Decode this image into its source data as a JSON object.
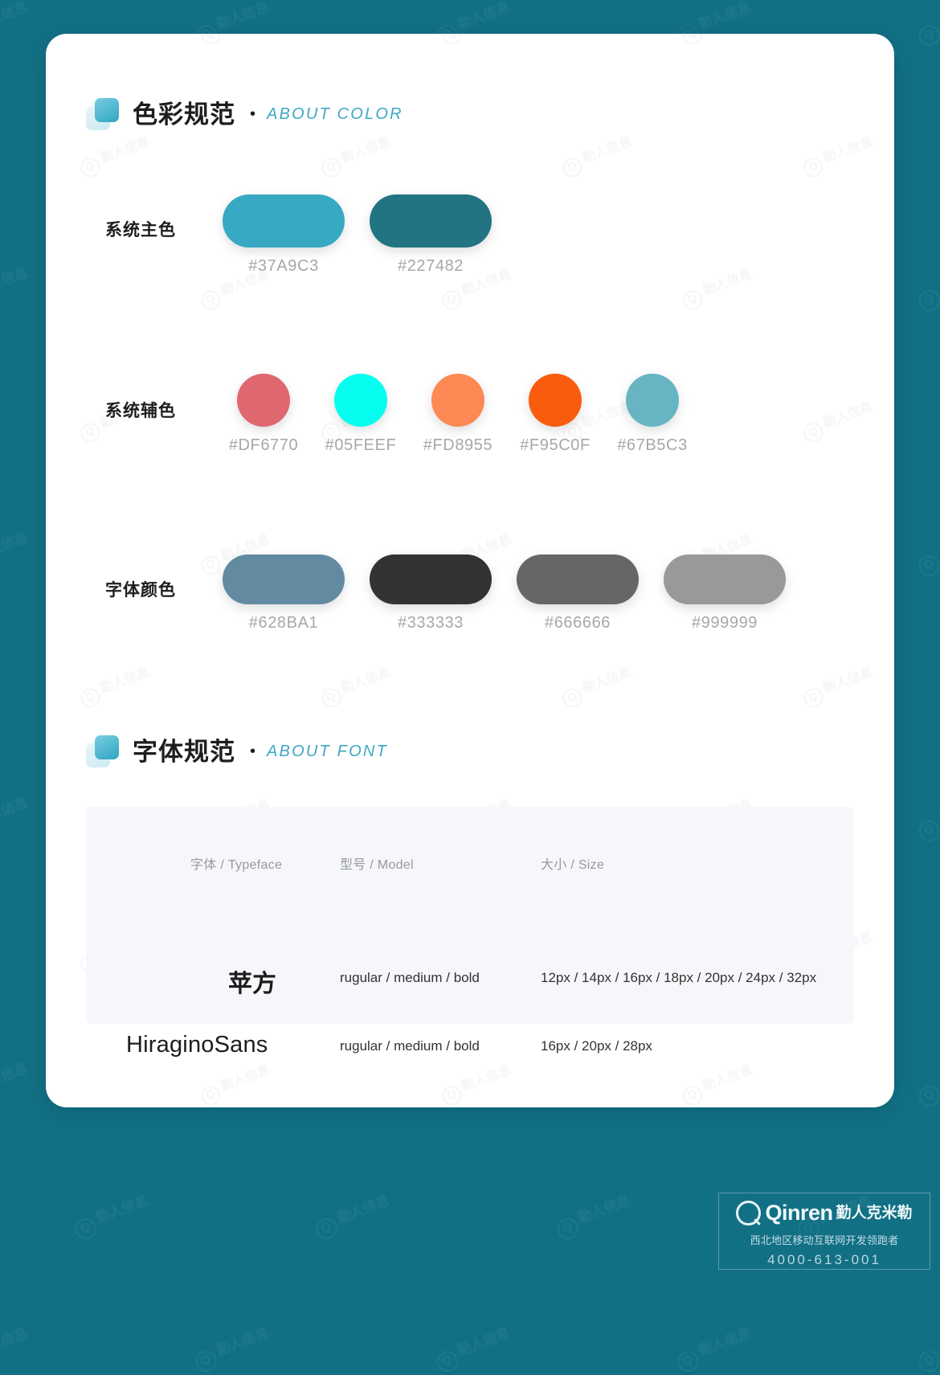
{
  "page": {
    "background_color": "#127085",
    "card_color": "#FFFFFF"
  },
  "sections": [
    {
      "id": "color",
      "title_cn": "色彩规范",
      "separator": "•",
      "title_en": "ABOUT COLOR"
    },
    {
      "id": "font",
      "title_cn": "字体规范",
      "separator": "•",
      "title_en": "ABOUT FONT"
    }
  ],
  "color_groups": [
    {
      "label": "系统主色",
      "shape": "pill",
      "swatches": [
        {
          "code": "#37A9C3",
          "color": "#37A9C3"
        },
        {
          "code": "#227482",
          "color": "#227482"
        }
      ]
    },
    {
      "label": "系统辅色",
      "shape": "circle",
      "swatches": [
        {
          "code": "#DF6770",
          "color": "#DF6770"
        },
        {
          "code": "#05FEEF",
          "color": "#05FEEF"
        },
        {
          "code": "#FD8955",
          "color": "#FD8955"
        },
        {
          "code": "#F95C0F",
          "color": "#F95C0F"
        },
        {
          "code": "#67B5C3",
          "color": "#67B5C3"
        }
      ]
    },
    {
      "label": "字体颜色",
      "shape": "pill",
      "swatches": [
        {
          "code": "#628BA1",
          "color": "#628BA1"
        },
        {
          "code": "#333333",
          "color": "#333333"
        },
        {
          "code": "#666666",
          "color": "#666666"
        },
        {
          "code": "#999999",
          "color": "#999999"
        }
      ]
    }
  ],
  "font_table": {
    "headers": [
      "字体 / Typeface",
      "型号 / Model",
      "大小 / Size"
    ],
    "rows": [
      {
        "typeface": "苹方",
        "model": "rugular / medium / bold",
        "size": "12px / 14px / 16px / 18px / 20px / 24px / 32px"
      },
      {
        "typeface": "HiraginoSans",
        "model": "rugular / medium / bold",
        "size": "16px / 20px / 28px"
      }
    ]
  },
  "footer": {
    "brand_en": "Qinren",
    "brand_cn": "勤人克米勒",
    "tagline": "西北地区移动互联网开发领跑者",
    "phone": "4000-613-001"
  },
  "watermark": {
    "text": "勤人信息",
    "mark": "Q"
  }
}
